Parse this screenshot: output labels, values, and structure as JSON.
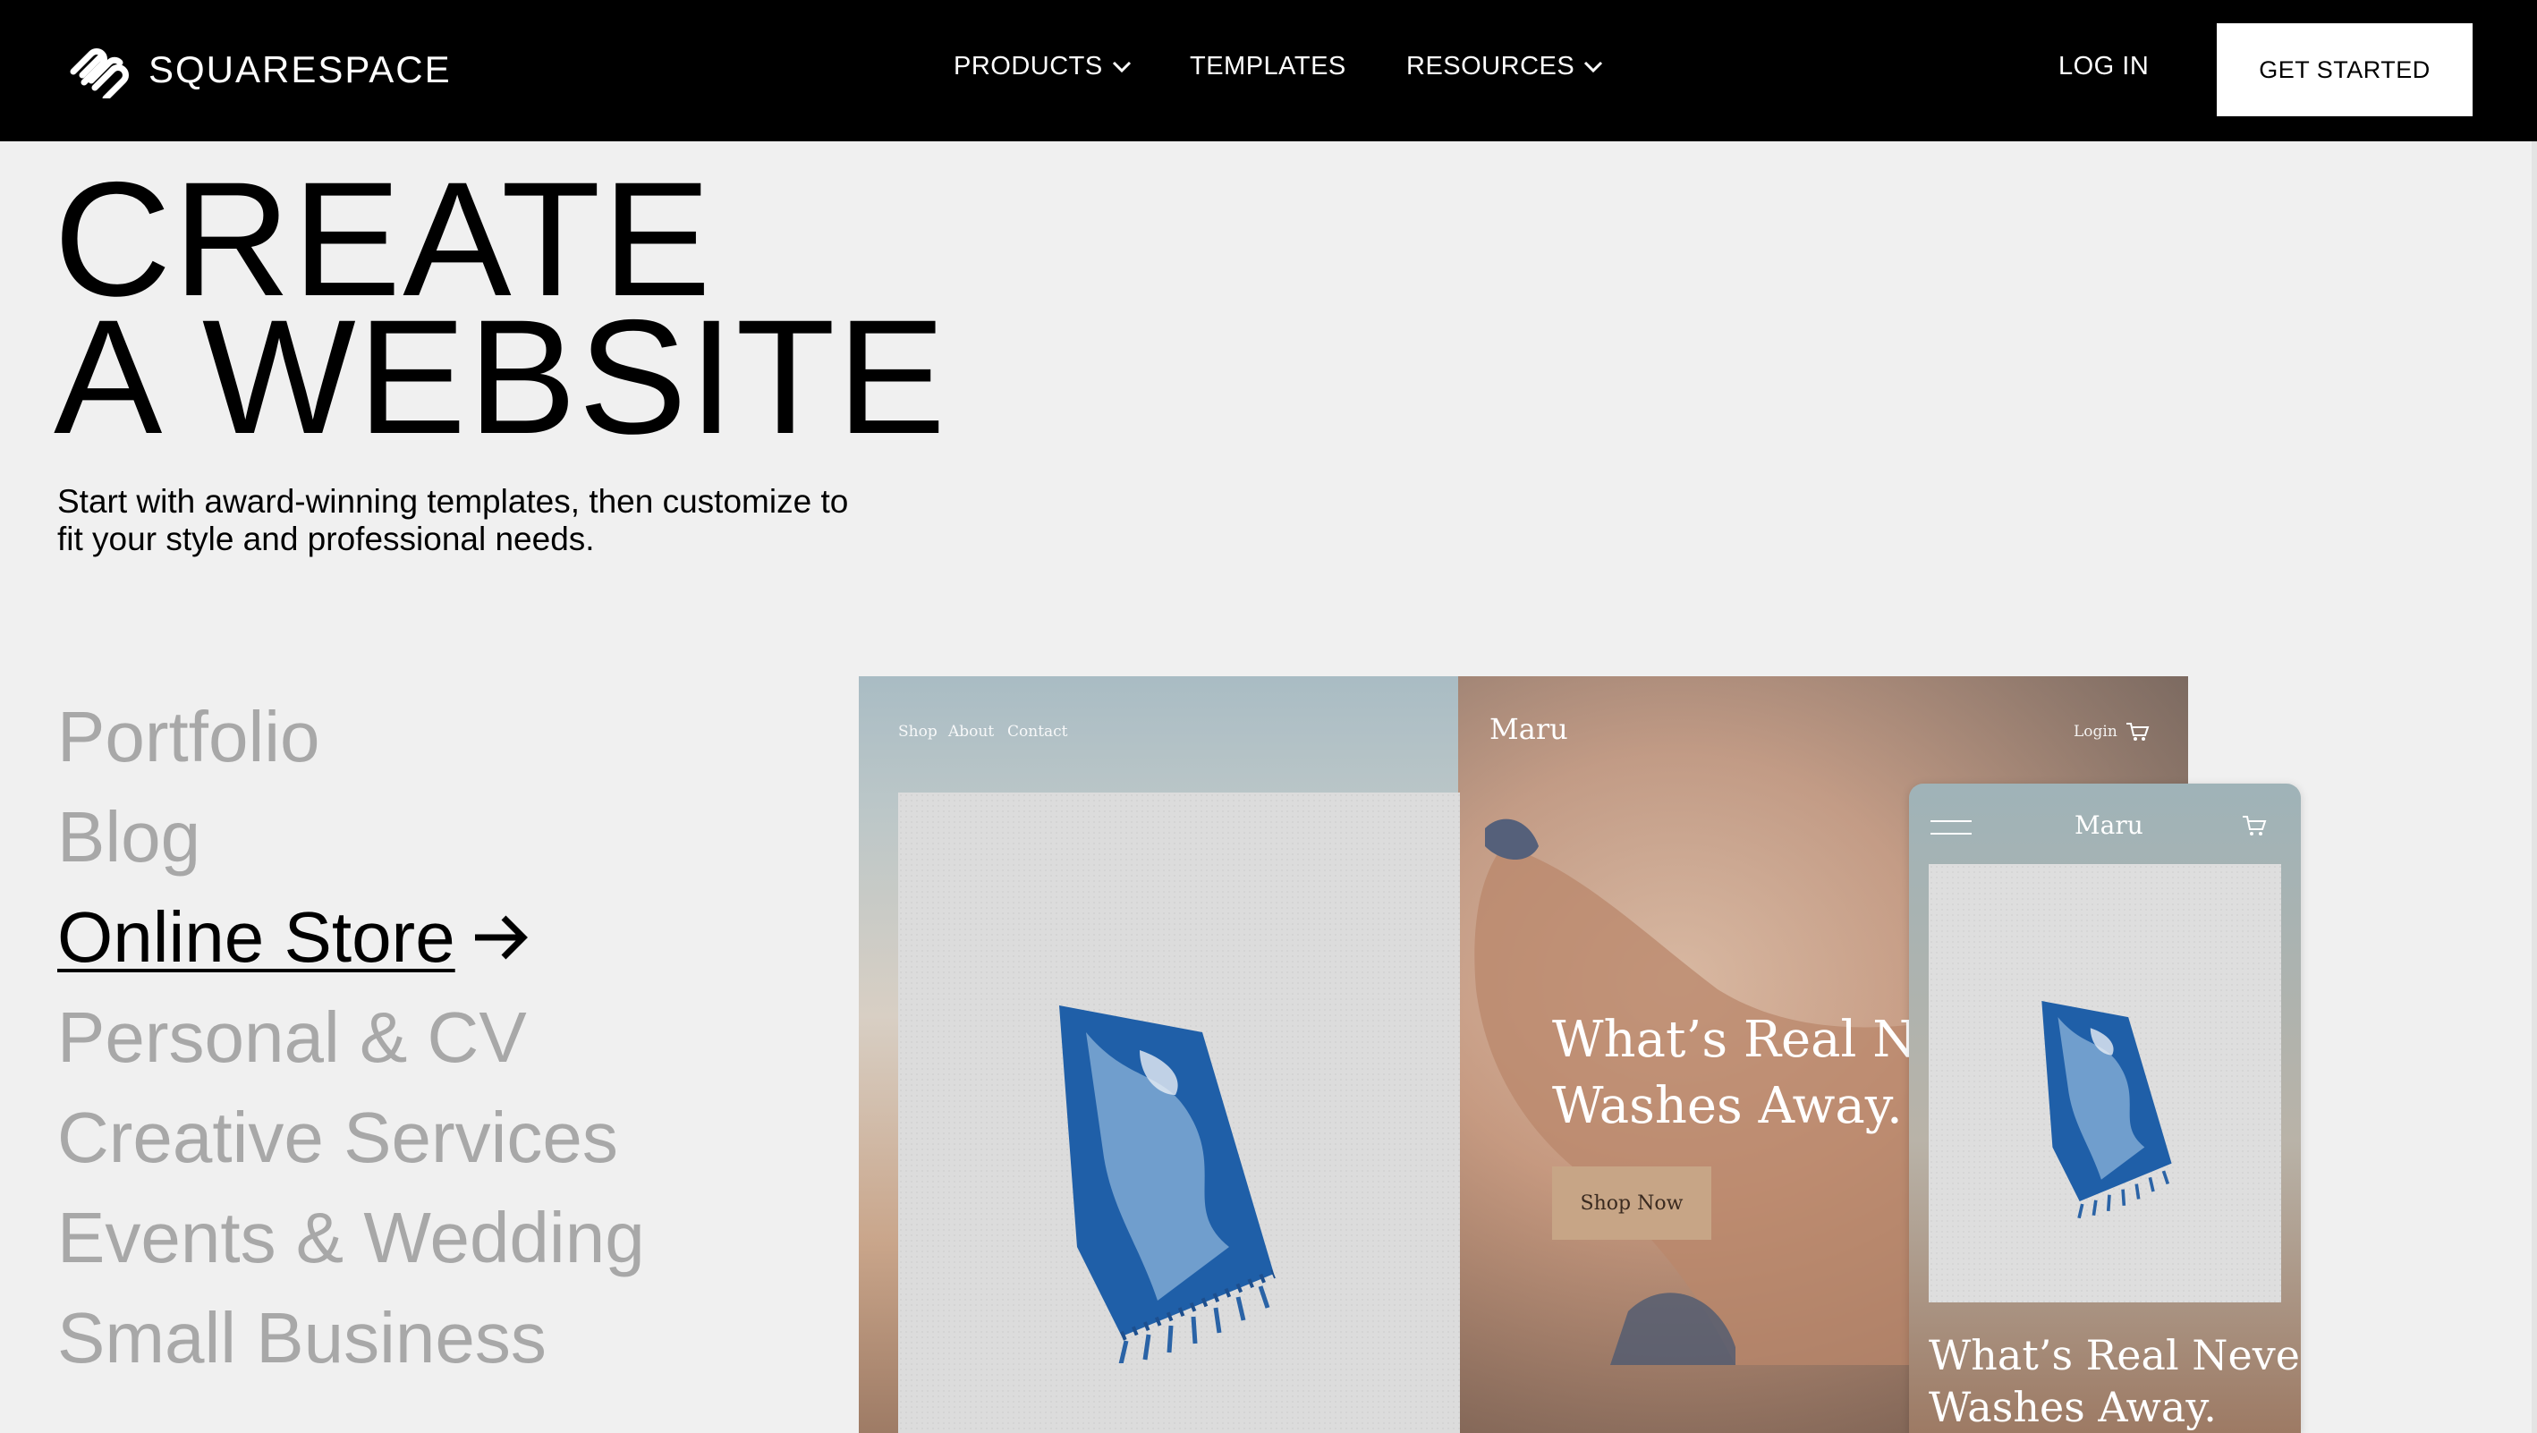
{
  "header": {
    "logo_text": "SQUARESPACE",
    "nav": {
      "products": "PRODUCTS",
      "templates": "TEMPLATES",
      "resources": "RESOURCES",
      "login": "LOG IN",
      "get_started": "GET STARTED"
    }
  },
  "hero": {
    "headline_line1": "CREATE",
    "headline_line2": "A WEBSITE",
    "subhead": "Start with award-winning templates, then customize to fit your style and professional needs."
  },
  "categories": [
    {
      "label": "Portfolio",
      "active": false
    },
    {
      "label": "Blog",
      "active": false
    },
    {
      "label": "Online Store",
      "active": true
    },
    {
      "label": "Personal & CV",
      "active": false
    },
    {
      "label": "Creative Services",
      "active": false
    },
    {
      "label": "Events & Wedding",
      "active": false
    },
    {
      "label": "Small Business",
      "active": false
    }
  ],
  "preview": {
    "nav_shop": "Shop",
    "nav_about": "About",
    "nav_contact": "Contact",
    "brand": "Maru",
    "login": "Login",
    "heading_line1": "What’s Real Nev",
    "heading_line2": "Washes Away.",
    "button": "Shop Now",
    "mobile_brand": "Maru",
    "mobile_heading_line1": "What’s Real Never",
    "mobile_heading_line2": "Washes Away."
  },
  "colors": {
    "nav_bg": "#000000",
    "page_bg": "#f0f0f0",
    "inactive_category": "#a8a8a8",
    "shop_button": "#c7a586"
  },
  "icons": [
    "squarespace-logo-icon",
    "chevron-down-icon",
    "arrow-right-icon",
    "cart-icon",
    "hamburger-menu-icon"
  ]
}
